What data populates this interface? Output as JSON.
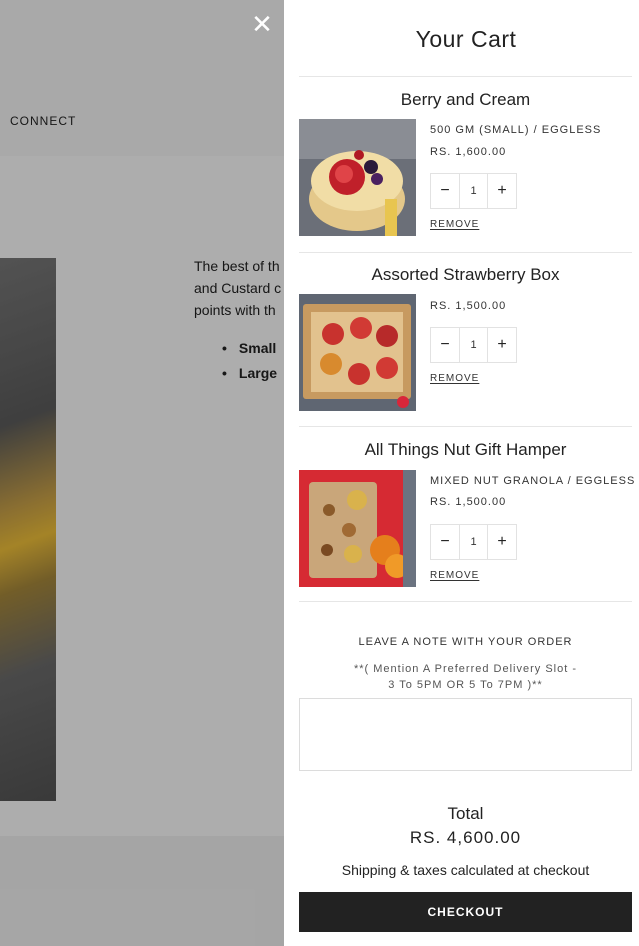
{
  "background_page": {
    "nav_connect": "CONNECT",
    "description_lines": [
      "The best of th",
      "and Custard c",
      "points with th"
    ],
    "size_options": [
      "Small",
      "Large"
    ]
  },
  "cart": {
    "title": "Your Cart",
    "close_icon": "close-icon",
    "items": [
      {
        "name": "Berry and Cream",
        "variant": "500 GM (SMALL) / EGGLESS",
        "price": "RS. 1,600.00",
        "quantity": "1",
        "remove_label": "REMOVE",
        "image": "berry-cream-cake-image"
      },
      {
        "name": "Assorted Strawberry Box",
        "variant": "",
        "price": "RS. 1,500.00",
        "quantity": "1",
        "remove_label": "REMOVE",
        "image": "strawberry-box-image"
      },
      {
        "name": "All Things Nut Gift Hamper",
        "variant": "MIXED NUT GRANOLA / EGGLESS",
        "price": "RS. 1,500.00",
        "quantity": "1",
        "remove_label": "REMOVE",
        "image": "nut-gift-hamper-image"
      }
    ],
    "note": {
      "label": "LEAVE A NOTE WITH YOUR ORDER",
      "hint_line1": "**( Mention A Preferred Delivery Slot -",
      "hint_line2": "3 To 5PM OR 5 To 7PM )**",
      "value": ""
    },
    "total_label": "Total",
    "total_value": "RS. 4,600.00",
    "shipping_note": "Shipping & taxes calculated at checkout",
    "checkout_label": "CHECKOUT"
  },
  "colors": {
    "overlay": "#000000",
    "checkout_bg": "#222222",
    "drawer_bg": "#ffffff"
  }
}
